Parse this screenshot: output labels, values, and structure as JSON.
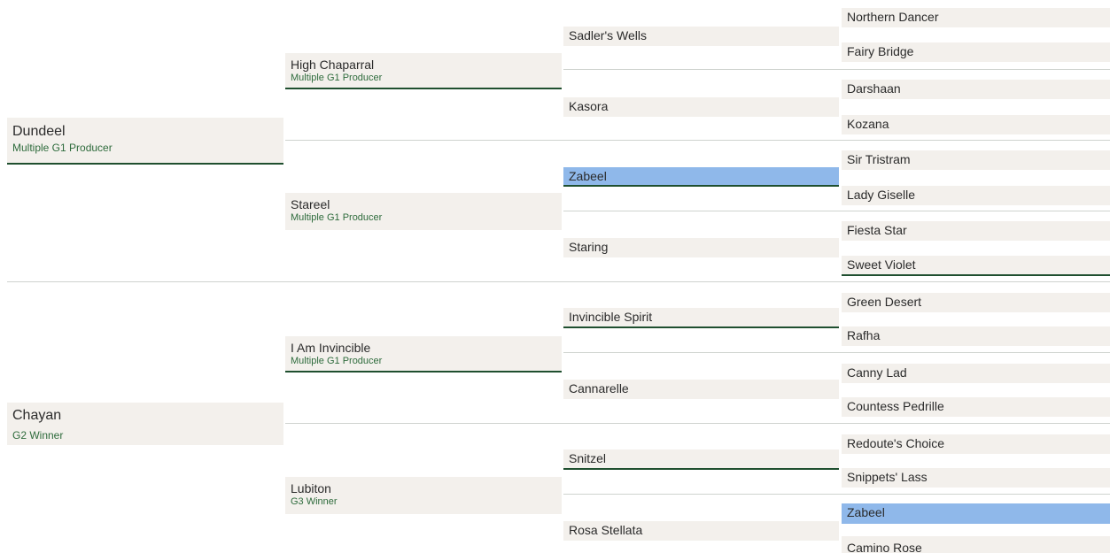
{
  "pedigree": {
    "g1": [
      {
        "name": "Dundeel",
        "note": "Multiple G1 Producer"
      },
      {
        "name": "Chayan",
        "note": "G2 Winner"
      }
    ],
    "g2": [
      {
        "name": "High Chaparral",
        "note": "Multiple G1 Producer"
      },
      {
        "name": "Stareel",
        "note": "Multiple G1 Producer"
      },
      {
        "name": "I Am Invincible",
        "note": "Multiple G1 Producer"
      },
      {
        "name": "Lubiton",
        "note": "G3 Winner"
      }
    ],
    "g3": [
      {
        "name": "Sadler's Wells"
      },
      {
        "name": "Kasora"
      },
      {
        "name": "Zabeel"
      },
      {
        "name": "Staring"
      },
      {
        "name": "Invincible Spirit"
      },
      {
        "name": "Cannarelle"
      },
      {
        "name": "Snitzel"
      },
      {
        "name": "Rosa Stellata"
      }
    ],
    "g4": [
      {
        "name": "Northern Dancer"
      },
      {
        "name": "Fairy Bridge"
      },
      {
        "name": "Darshaan"
      },
      {
        "name": "Kozana"
      },
      {
        "name": "Sir Tristram"
      },
      {
        "name": "Lady Giselle"
      },
      {
        "name": "Fiesta Star"
      },
      {
        "name": "Sweet Violet"
      },
      {
        "name": "Green Desert"
      },
      {
        "name": "Rafha"
      },
      {
        "name": "Canny Lad"
      },
      {
        "name": "Countess Pedrille"
      },
      {
        "name": "Redoute's Choice"
      },
      {
        "name": "Snippets' Lass"
      },
      {
        "name": "Zabeel"
      },
      {
        "name": "Camino Rose"
      }
    ],
    "highlight_color": "#8fb8ea",
    "accent_color": "#1f4f2f",
    "note_color": "#2e6b3c"
  }
}
